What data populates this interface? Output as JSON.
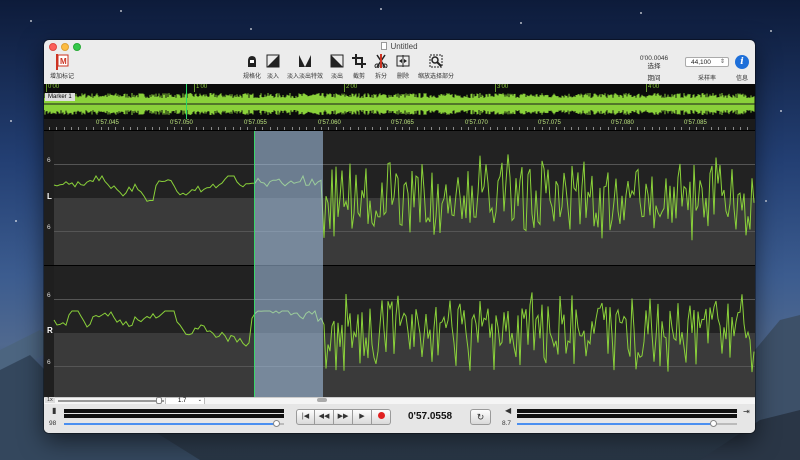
{
  "window": {
    "title": "Untitled"
  },
  "toolbar": {
    "add_marker": "增加标记",
    "normalize": "规格化",
    "fade_in": "淡入",
    "fade_in_out": "淡入淡出特效",
    "fade_out": "淡出",
    "crop": "截剪",
    "split": "拆分",
    "delete": "删除",
    "zoom_selection": "缩放选择部分"
  },
  "selection": {
    "duration": "0'00.0046",
    "label": "选择",
    "period_label": "期间"
  },
  "sample_rate": {
    "value": "44,100",
    "label": "采样率"
  },
  "info": {
    "label": "信息",
    "glyph": "i"
  },
  "overview": {
    "marker_label": "Marker 1",
    "ticks": [
      "0'00",
      "1'00",
      "2'00",
      "3'00",
      "4'00"
    ]
  },
  "ruler": {
    "ticks": [
      "0'57.045",
      "0'57.050",
      "0'57.055",
      "0'57.060",
      "0'57.065",
      "0'57.070",
      "0'57.075",
      "0'57.080",
      "0'57.085"
    ]
  },
  "tracks": {
    "left": {
      "channel": "L",
      "top_value": "6",
      "bottom_value": "6"
    },
    "right": {
      "channel": "R",
      "top_value": "6",
      "bottom_value": "6"
    }
  },
  "zoom": {
    "level_label": "1x",
    "selected": "1.7"
  },
  "transport": {
    "time": "0'57.0558",
    "input_level": "98",
    "output_level": "8.7",
    "buttons": [
      "skip-back",
      "rewind",
      "fast-forward",
      "play",
      "record",
      "loop"
    ]
  },
  "colors": {
    "waveform": "#8ad13a",
    "selection": "#aac8eb",
    "cursor": "#2bd96a",
    "record": "#e02020",
    "info": "#1e6fd9"
  }
}
